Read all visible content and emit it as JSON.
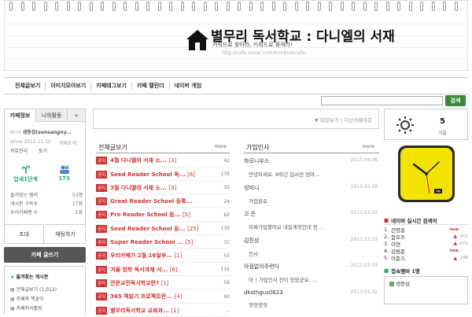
{
  "header": {
    "title": "별무리 독서학교 : 다니엘의 서재",
    "subtitle": "키워드로 찾아라, 키워드로 뭉쳐라!",
    "url": "http://cafe.naver.com/bmrbookcafe"
  },
  "menu": [
    "전체글보기",
    "이미지모아보기",
    "카페태그보기",
    "카페 캘린더",
    "네이버 게임"
  ],
  "search": {
    "button": "검색",
    "value": ""
  },
  "left": {
    "tabs": [
      "카페정보",
      "나의활동",
      "★"
    ],
    "manager_label": "매니저",
    "manager": "생종섬(sunsangny...",
    "since": "since 2012.11.12",
    "cafe_intro": "카페소개",
    "cafe_manage": "커뮤관리",
    "rank": "토기",
    "level": "업새1단계",
    "members": "173",
    "stats": [
      {
        "label": "즐겨찾는 멤버",
        "value": "53명"
      },
      {
        "label": "게시판 구독수",
        "value": "17회"
      },
      {
        "label": "우리카페랭 수",
        "value": "1회"
      }
    ],
    "invite": "초대",
    "chat": "채팅하기",
    "write": "카페 글쓰기",
    "fav_title": "즐겨찾는 게시판",
    "fav_items": [
      "전체글보기 (1,012)",
      "카페북 책꽂이",
      "카페지식활동"
    ]
  },
  "notice_box": {
    "label": "대문보기",
    "label2": "지난카페대문"
  },
  "all_posts": {
    "title": "전체글보기",
    "more": "more",
    "badge": "공지",
    "rows": [
      {
        "title": "4월 다니엘의 서재 소...",
        "c": "[3]",
        "n": "42"
      },
      {
        "title": "Seed Reader School 독...",
        "c": "[6]",
        "n": "176"
      },
      {
        "title": "3월 다니엘의 서재 소...",
        "c": "[3]",
        "n": "32"
      },
      {
        "title": "Great Reader School 등록...",
        "c": "",
        "n": "24"
      },
      {
        "title": "Pro Reader School 등...",
        "c": "[5]",
        "n": "62"
      },
      {
        "title": "Seed Reader School 등...",
        "c": "[25]",
        "n": "139"
      },
      {
        "title": "Super Reader School ...",
        "c": "[5]",
        "n": "31"
      },
      {
        "title": "우리카페가 2월 16일부...",
        "c": "[1]",
        "n": "53"
      },
      {
        "title": "겨울 방학 독서과제 서...",
        "c": "[6]",
        "n": "116"
      },
      {
        "title": "안문교전독서학교란?",
        "c": "[1]",
        "n": "58"
      },
      {
        "title": "365 책읽기 프로젝트란...",
        "c": "[4]",
        "n": "60"
      },
      {
        "title": "별무리독서학교 교육과...",
        "c": "[1]",
        "n": "..."
      }
    ]
  },
  "greetings": {
    "title": "가입인사",
    "more": "more",
    "rows": [
      {
        "name": "하모니우스",
        "date": "2013.04.08",
        "msg": "안녕하세요. 9학년 입서연 엄마..."
      },
      {
        "name": "성미니",
        "date": "2013.03.28",
        "msg": "가입완료"
      },
      {
        "name": "고 은",
        "date": "2013.03.03",
        "msg": "이제가입했어요 내일계학인데 전..."
      },
      {
        "name": "김진성",
        "date": "2013.03.03",
        "msg": "인사"
      },
      {
        "name": "아점없이주련다",
        "date": "2013.03.03",
        "msg": "아 ! 가입인사 칸이 있었군요. ..."
      },
      {
        "name": "dksthgus0823",
        "date": "2013.03.02",
        "msg": "핫핫핫핫"
      }
    ]
  },
  "weather": {
    "temp": "5",
    "label": "서울"
  },
  "ranking": {
    "title": "네이버 실시간 검색어",
    "items": [
      {
        "rank": "1.",
        "name": "건명흥",
        "tag": "new",
        "count": ""
      },
      {
        "rank": "2.",
        "name": "함호주",
        "tag": "up",
        "count": "252"
      },
      {
        "rank": "3.",
        "name": "이연",
        "tag": "up",
        "count": "972"
      },
      {
        "rank": "4.",
        "name": "김범준",
        "tag": "new",
        "count": ""
      },
      {
        "rank": "5.",
        "name": "이준기",
        "tag": "up",
        "count": "198"
      }
    ]
  },
  "online": {
    "title": "접속멤버 1명",
    "member": "생종섬"
  },
  "colors": {
    "accent": "#3a8a3a",
    "notice": "#cc3333",
    "clock": "#f3e300"
  }
}
